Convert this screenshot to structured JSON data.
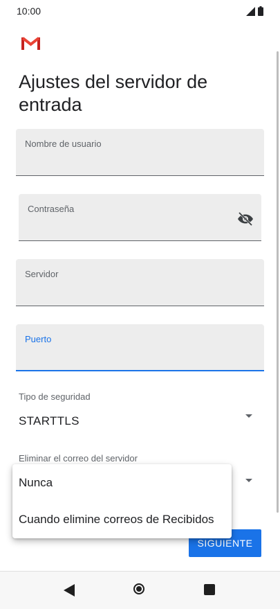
{
  "status_bar": {
    "time": "10:00",
    "icons": [
      "signal-icon",
      "battery-icon"
    ]
  },
  "app": {
    "logo": "gmail-logo-icon",
    "title": "Ajustes del servidor de entrada"
  },
  "form": {
    "username": {
      "label": "Nombre de usuario",
      "value": ""
    },
    "password": {
      "label": "Contraseña",
      "value": "",
      "icon": "visibility-off-icon"
    },
    "server": {
      "label": "Servidor",
      "value": ""
    },
    "port": {
      "label": "Puerto",
      "value": ""
    },
    "security": {
      "label": "Tipo de seguridad",
      "value": "STARTTLS"
    },
    "delete_from_server": {
      "label": "Eliminar el correo del servidor"
    },
    "next_label": "SIGUIENTE"
  },
  "dropdown_menu": {
    "items": [
      "Nunca",
      "Cuando elimine correos de Recibidos"
    ]
  },
  "colors": {
    "accent": "#1a73e8",
    "field_bg": "#ededed",
    "text_primary": "#202124",
    "text_secondary": "#5f6368"
  },
  "nav": {
    "icons": [
      "back-icon",
      "home-icon",
      "recents-icon"
    ]
  }
}
